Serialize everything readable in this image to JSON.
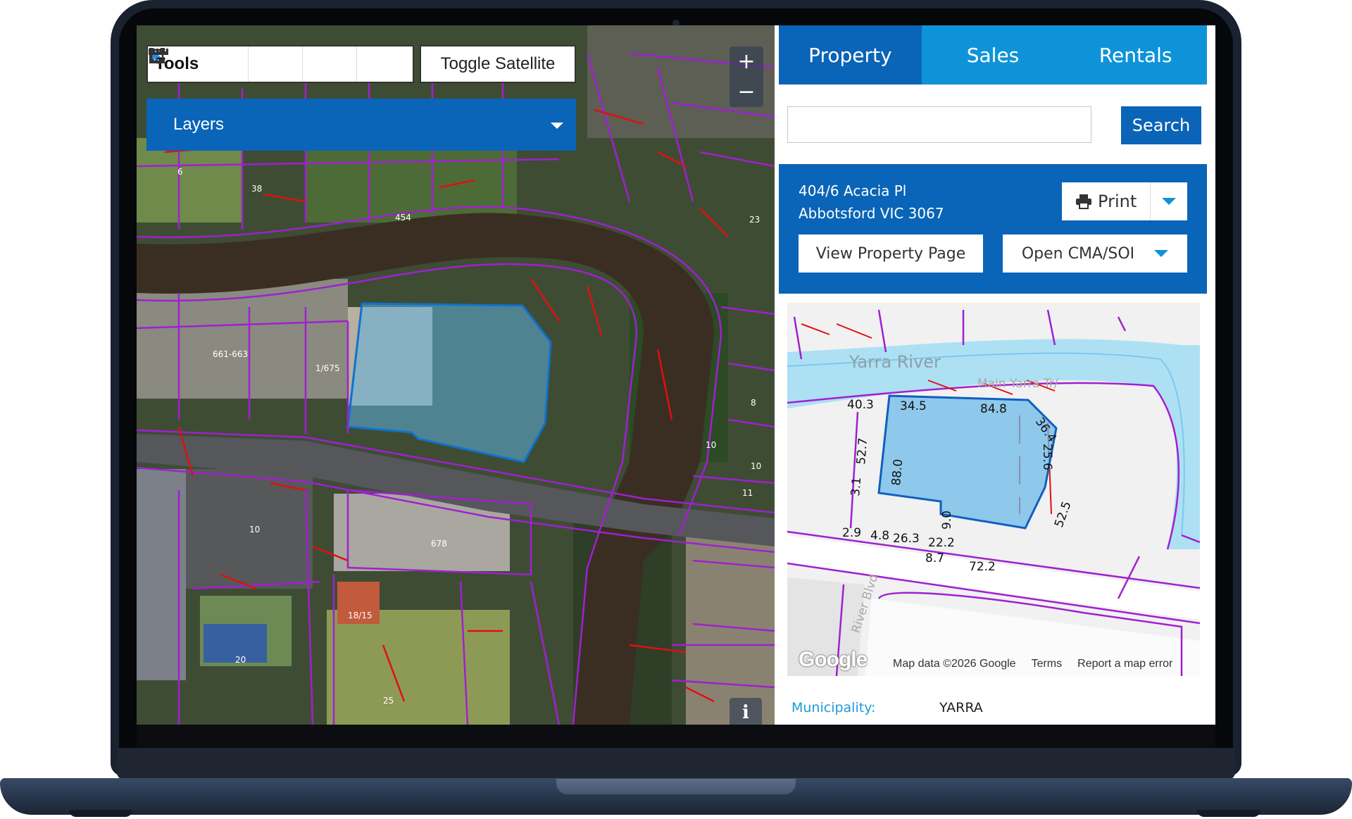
{
  "map": {
    "tools_label": "Tools",
    "tool_icons": [
      "cursor-icon",
      "ruler-icon",
      "corner-measure-icon",
      "polygon-select-icon"
    ],
    "toggle_satellite_label": "Toggle Satellite",
    "layers_label": "Layers",
    "zoom_in_label": "+",
    "zoom_out_label": "−",
    "info_label": "i",
    "parcel_labels": [
      "6",
      "38",
      "454",
      "1/675",
      "661-663",
      "10",
      "678",
      "18/15",
      "25",
      "20",
      "10",
      "23",
      "8",
      "10",
      "11"
    ]
  },
  "panel": {
    "tabs": [
      {
        "label": "Property",
        "active": true
      },
      {
        "label": "Sales",
        "active": false
      },
      {
        "label": "Rentals",
        "active": false
      }
    ],
    "search": {
      "placeholder": "",
      "button_label": "Search"
    },
    "property": {
      "address_line1": "404/6 Acacia Pl",
      "address_line2": "Abbotsford VIC 3067",
      "print_label": "Print",
      "view_property_label": "View Property Page",
      "open_cma_label": "Open CMA/SOI"
    },
    "minimap": {
      "river_label": "Yarra River",
      "road_label": "Main Yarra Tr/",
      "road2_label": "River Blvd",
      "dimensions": [
        "40.3",
        "34.5",
        "84.8",
        "36.4",
        "25.6",
        "52.7",
        "88.0",
        "3.1",
        "52.5",
        "2.9",
        "4.8",
        "26.3",
        "22.2",
        "8.7",
        "72.2",
        "9.0"
      ],
      "google_label": "Google",
      "footer_data": "Map data ©2026 Google",
      "footer_terms": "Terms",
      "footer_report": "Report a map error"
    },
    "municipality_label": "Municipality:",
    "municipality_value": "YARRA"
  },
  "colors": {
    "primary_blue": "#0a64b7",
    "tab_blue": "#0e93d8",
    "boundary_purple": "#a020d0",
    "boundary_red": "#e01010",
    "parcel_fill": "#5fb0e0"
  }
}
